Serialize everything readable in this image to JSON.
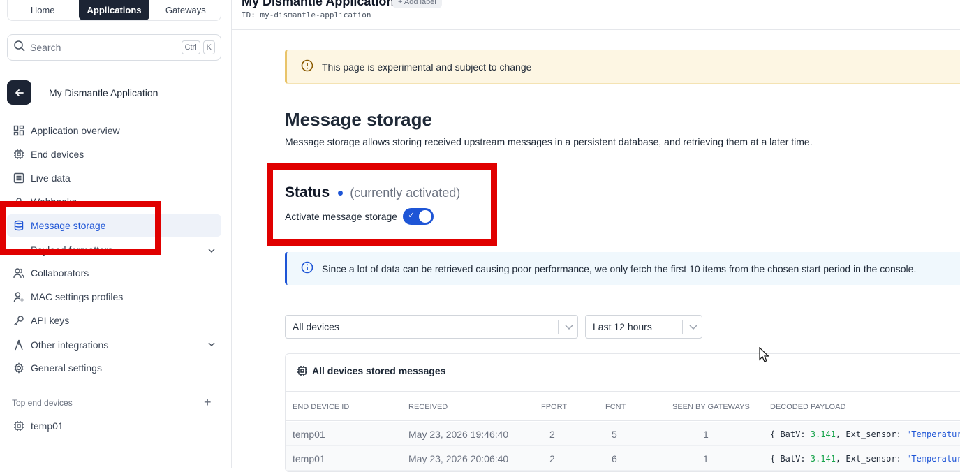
{
  "top_tabs": [
    {
      "label": "Home",
      "active": false
    },
    {
      "label": "Applications",
      "active": true
    },
    {
      "label": "Gateways",
      "active": false
    }
  ],
  "search": {
    "placeholder": "Search",
    "kbd1": "Ctrl",
    "kbd2": "K"
  },
  "app": {
    "name": "My Dismantle Application",
    "title": "My Dismantle Application",
    "id_label": "ID:",
    "id": "my-dismantle-application",
    "add_label": "Add label"
  },
  "nav": {
    "items": [
      {
        "label": "Application overview",
        "icon": "grid-icon"
      },
      {
        "label": "End devices",
        "icon": "chip-icon"
      },
      {
        "label": "Live data",
        "icon": "list-icon"
      },
      {
        "label": "Webhooks",
        "icon": "webhook-icon"
      },
      {
        "label": "Message storage",
        "icon": "database-icon",
        "active": true
      },
      {
        "label": "Payload formatters",
        "icon": "code-icon",
        "expandable": true
      },
      {
        "label": "Collaborators",
        "icon": "users-icon"
      },
      {
        "label": "MAC settings profiles",
        "icon": "user-plus-icon"
      },
      {
        "label": "API keys",
        "icon": "key-icon"
      },
      {
        "label": "Other integrations",
        "icon": "integration-icon",
        "expandable": true
      },
      {
        "label": "General settings",
        "icon": "gear-icon"
      }
    ]
  },
  "top_devices": {
    "title": "Top end devices",
    "items": [
      {
        "label": "temp01"
      }
    ]
  },
  "warning": {
    "text": "This page is experimental and subject to change"
  },
  "page": {
    "heading": "Message storage",
    "description": "Message storage allows storing received upstream messages in a persistent database, and retrieving them at a later time."
  },
  "status": {
    "title": "Status",
    "sub": "(currently activated)",
    "toggle_label": "Activate message storage",
    "enabled": true
  },
  "info": {
    "text": "Since a lot of data can be retrieved causing poor performance, we only fetch the first 10 items from the chosen start period in the console."
  },
  "filters": {
    "device": "All devices",
    "period": "Last 12 hours"
  },
  "table": {
    "title": "All devices stored messages",
    "columns": [
      "END DEVICE ID",
      "RECEIVED",
      "FPORT",
      "FCNT",
      "SEEN BY GATEWAYS",
      "DECODED PAYLOAD"
    ],
    "rows": [
      {
        "device": "temp01",
        "received": "May 23, 2026 19:46:40",
        "fport": "2",
        "fcnt": "5",
        "gateways": "1",
        "p_open": "{ BatV: ",
        "p_num": "3.141",
        "p_mid": ", Ext_sensor: ",
        "p_str": "\"Temperatur"
      },
      {
        "device": "temp01",
        "received": "May 23, 2026 20:06:40",
        "fport": "2",
        "fcnt": "6",
        "gateways": "1",
        "p_open": "{ BatV: ",
        "p_num": "3.141",
        "p_mid": ", Ext_sensor: ",
        "p_str": "\"Temperatur"
      }
    ]
  },
  "colors": {
    "primary": "#1e55d6",
    "dark": "#1c2434",
    "highlight": "#e00000"
  }
}
